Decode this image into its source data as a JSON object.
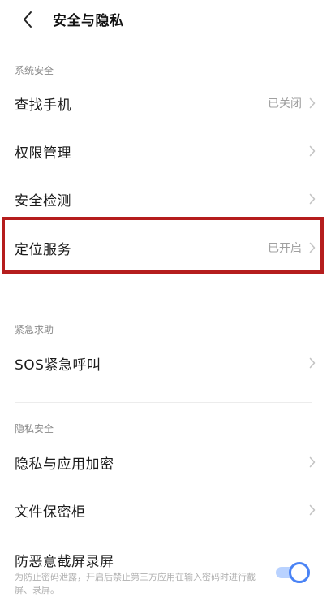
{
  "header": {
    "title": "安全与隐私",
    "back_icon": "chevron-left-icon"
  },
  "sections": {
    "system_security": {
      "label": "系统安全",
      "find_phone": {
        "label": "查找手机",
        "value": "已关闭"
      },
      "permission_management": {
        "label": "权限管理"
      },
      "security_check": {
        "label": "安全检测"
      },
      "location_service": {
        "label": "定位服务",
        "value": "已开启"
      }
    },
    "emergency": {
      "label": "紧急求助",
      "sos_call": {
        "label": "SOS紧急呼叫"
      }
    },
    "privacy": {
      "label": "隐私安全",
      "privacy_encryption": {
        "label": "隐私与应用加密"
      },
      "file_safe": {
        "label": "文件保密柜"
      },
      "anti_screenshot": {
        "label": "防恶意截屏录屏",
        "description": "为防止密码泄露，开启后禁止第三方应用在输入密码时进行截屏、录屏。",
        "enabled": true
      }
    }
  },
  "colors": {
    "highlight_border": "#b51d1d",
    "toggle_accent": "#4a83f5",
    "secondary_text": "#a0a0a0"
  },
  "icons": {
    "row_arrow": "chevron-right-icon"
  }
}
